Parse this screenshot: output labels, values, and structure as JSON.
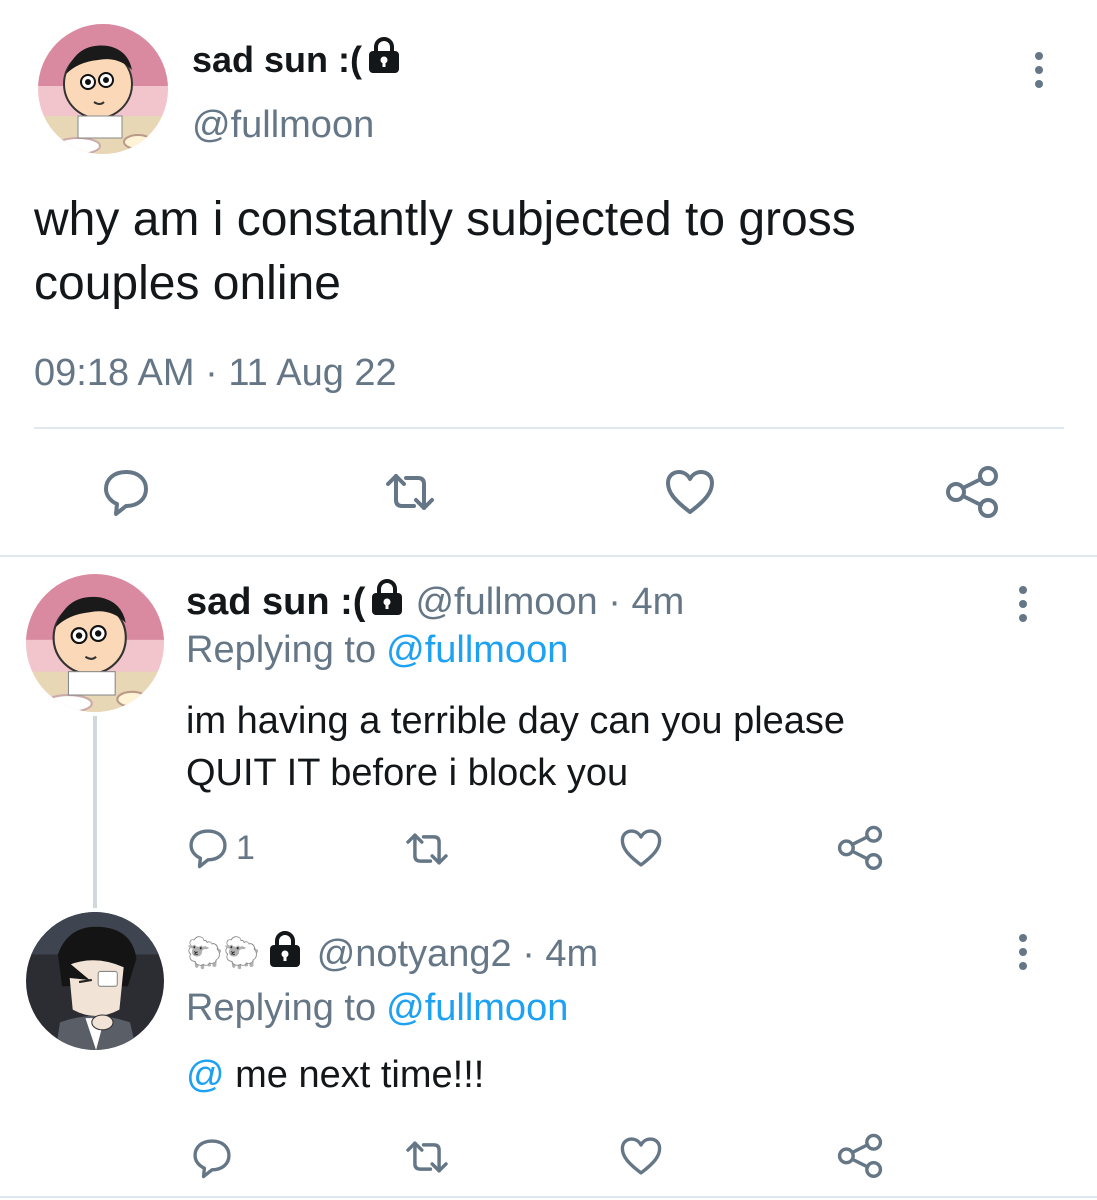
{
  "main_tweet": {
    "display_name": "sad sun :(",
    "handle": "@fullmoon",
    "text_line1": "why am i constantly subjected to gross",
    "text_line2": "couples online",
    "timestamp": "09:18 AM · 11 Aug 22"
  },
  "reply1": {
    "display_name": "sad sun :(",
    "handle_time": "@fullmoon · 4m",
    "replying_prefix": "Replying to",
    "replying_handle": "@fullmoon",
    "text_line1": "im having a terrible day can you please",
    "text_line2": "QUIT IT before i block you",
    "reply_count": "1"
  },
  "reply2": {
    "display_name_emoji": "🐑🐑",
    "handle_time": "@notyang2 · 4m",
    "replying_prefix": "Replying to",
    "replying_handle": "@fullmoon",
    "text_mention": "@",
    "text_rest": " me next time!!!"
  },
  "icons": [
    "lock-icon",
    "more-icon",
    "reply-icon",
    "retweet-icon",
    "like-icon",
    "share-icon"
  ],
  "colors": {
    "link": "#1da1f2",
    "secondary": "#657786",
    "text": "#14171a",
    "divider": "#e1e8ed"
  }
}
